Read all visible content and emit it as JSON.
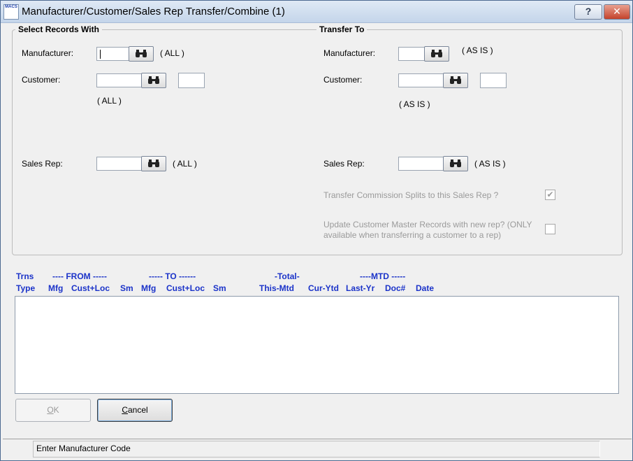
{
  "window": {
    "title": "Manufacturer/Customer/Sales Rep Transfer/Combine (1)",
    "app_icon_text": "MACS",
    "help_label": "?",
    "close_label": "✕"
  },
  "select_section": {
    "title": "Select Records With",
    "manufacturer_label": "Manufacturer:",
    "manufacturer_value": "",
    "manufacturer_note": "( ALL )",
    "customer_label": "Customer:",
    "customer_value": "",
    "customer_loc_value": "",
    "customer_note": "( ALL )",
    "salesrep_label": "Sales Rep:",
    "salesrep_value": "",
    "salesrep_note": "( ALL )"
  },
  "transfer_section": {
    "title": "Transfer To",
    "manufacturer_label": "Manufacturer:",
    "manufacturer_value": "",
    "manufacturer_note": "( AS IS )",
    "customer_label": "Customer:",
    "customer_value": "",
    "customer_loc_value": "",
    "customer_note": "( AS IS )",
    "salesrep_label": "Sales Rep:",
    "salesrep_value": "",
    "salesrep_note": "( AS IS )",
    "commission_label": "Transfer Commission Splits to this Sales Rep ?",
    "commission_checked": true,
    "update_label_line1": "Update Customer Master Records with new rep? (ONLY",
    "update_label_line2": "available when transferring a customer to a rep)",
    "update_checked": false
  },
  "columns": {
    "row1": {
      "trns": "Trns",
      "from": "---- FROM -----",
      "to": "----- TO ------",
      "total": "-Total-",
      "mtd": "----MTD -----"
    },
    "row2": {
      "type": "Type",
      "mfg1": "Mfg",
      "custloc1": "Cust+Loc",
      "sm1": "Sm",
      "mfg2": "Mfg",
      "custloc2": "Cust+Loc",
      "sm2": "Sm",
      "this_mtd": "This-Mtd",
      "cur_ytd": "Cur-Ytd",
      "last_yr": "Last-Yr",
      "doc": "Doc#",
      "date": "Date"
    }
  },
  "list_rows": [],
  "buttons": {
    "ok_pre": "",
    "ok_key": "O",
    "ok_post": "K",
    "cancel_pre": "",
    "cancel_key": "C",
    "cancel_post": "ancel"
  },
  "status": {
    "message": "Enter Manufacturer Code"
  },
  "colors": {
    "header_blue": "#1b33c9",
    "disabled_gray": "#9a9a9a"
  }
}
